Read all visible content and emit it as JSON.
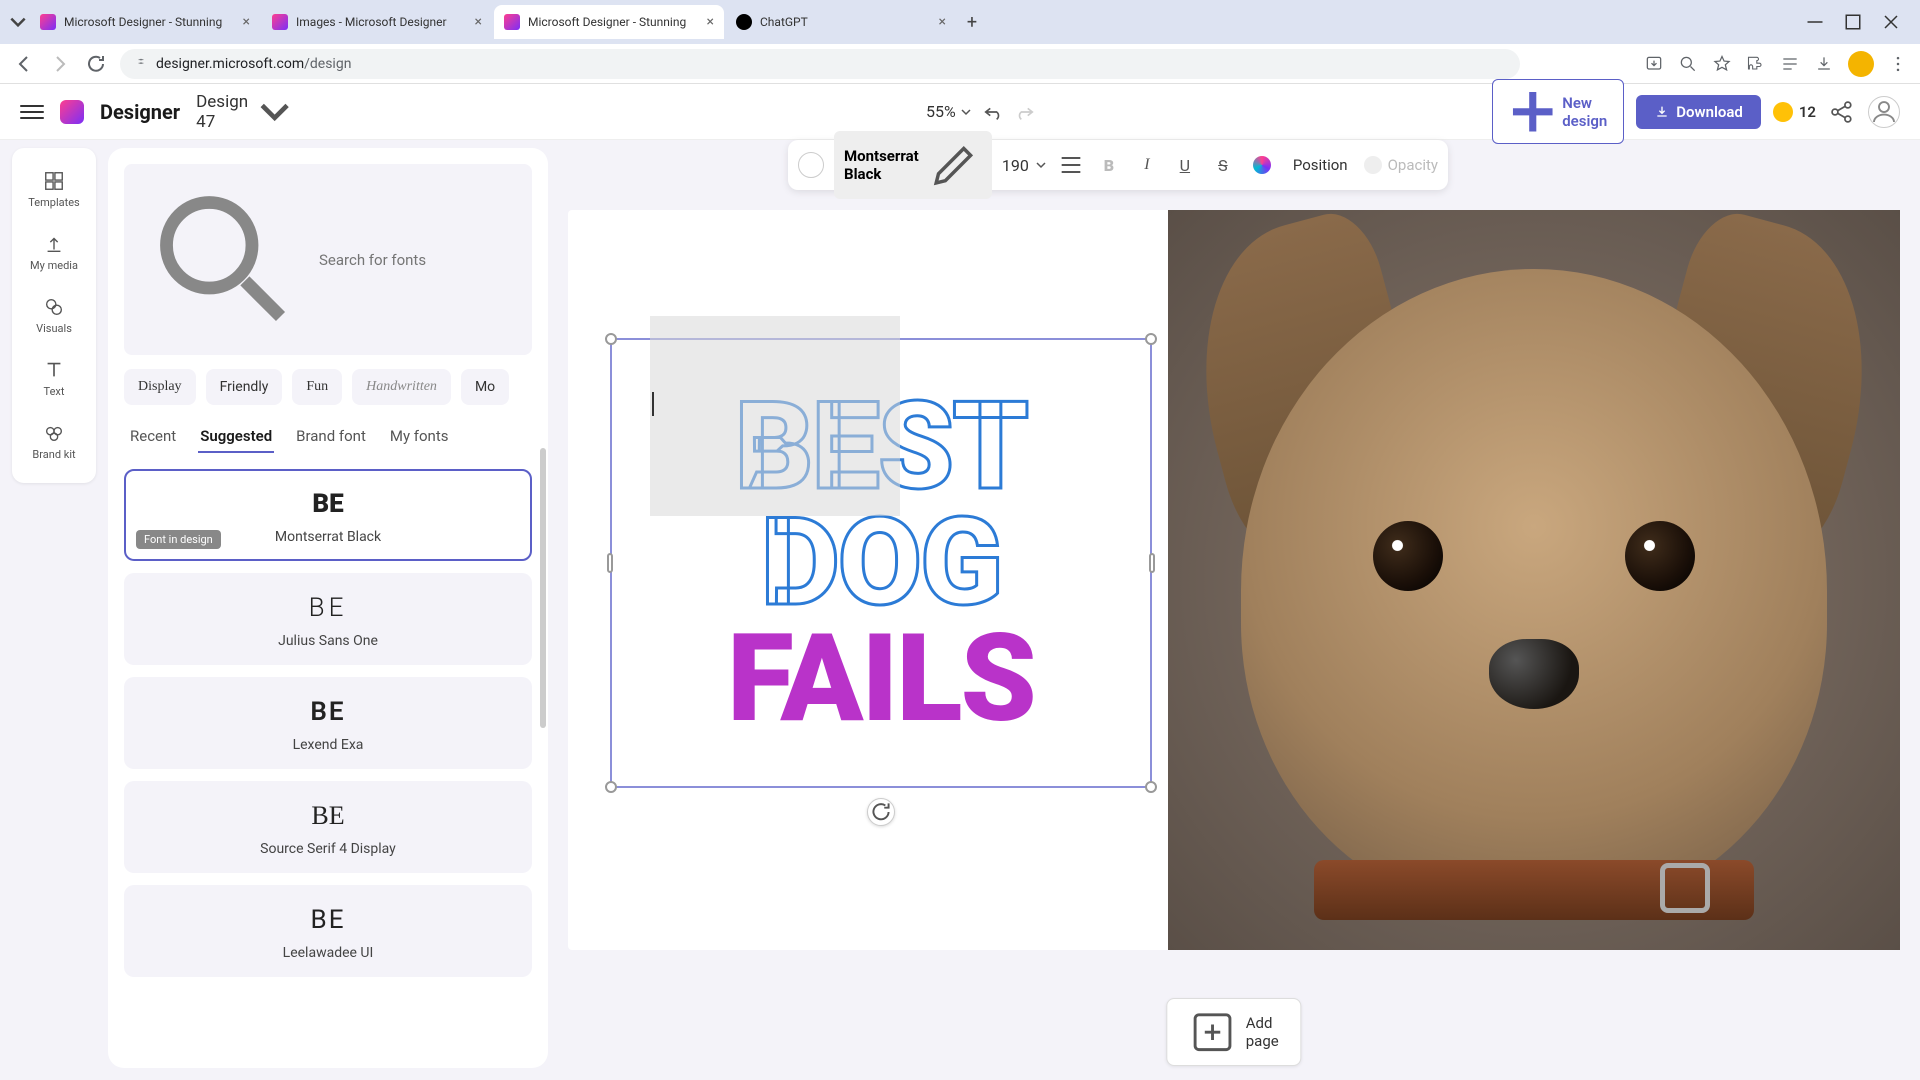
{
  "browser": {
    "tabs": [
      {
        "title": "Microsoft Designer - Stunning",
        "favicon": "designer"
      },
      {
        "title": "Images - Microsoft Designer",
        "favicon": "designer"
      },
      {
        "title": "Microsoft Designer - Stunning",
        "favicon": "designer",
        "active": true
      },
      {
        "title": "ChatGPT",
        "favicon": "chatgpt"
      }
    ],
    "url_domain": "designer.microsoft.com",
    "url_path": "/design"
  },
  "header": {
    "logo_text": "Designer",
    "design_name": "Design 47",
    "zoom": "55%",
    "new_design_label": "New design",
    "download_label": "Download",
    "credits": "12"
  },
  "rail": {
    "items": [
      {
        "label": "Templates",
        "icon": "templates-icon"
      },
      {
        "label": "My media",
        "icon": "upload-icon"
      },
      {
        "label": "Visuals",
        "icon": "visuals-icon"
      },
      {
        "label": "Text",
        "icon": "text-icon"
      },
      {
        "label": "Brand kit",
        "icon": "brandkit-icon"
      }
    ]
  },
  "font_panel": {
    "search_placeholder": "Search for fonts",
    "categories": [
      "Display",
      "Friendly",
      "Fun",
      "Handwritten",
      "Mo"
    ],
    "tabs": [
      "Recent",
      "Suggested",
      "Brand font",
      "My fonts"
    ],
    "active_tab": "Suggested",
    "sample_text": "BE",
    "in_design_badge": "Font in design",
    "fonts": [
      {
        "name": "Montserrat Black",
        "selected": true,
        "in_design": true,
        "style": "black"
      },
      {
        "name": "Julius Sans One",
        "style": "julius"
      },
      {
        "name": "Lexend Exa",
        "style": "lexend"
      },
      {
        "name": "Source Serif 4 Display",
        "style": "serif"
      },
      {
        "name": "Leelawadee UI",
        "style": "leela"
      }
    ]
  },
  "context_toolbar": {
    "font_name": "Montserrat Black",
    "font_size": "190",
    "position_label": "Position",
    "opacity_label": "Opacity"
  },
  "canvas": {
    "text_lines": [
      "BEST",
      "DOG",
      "FAILS"
    ],
    "outline_color": "#2c7bd6",
    "fill_color": "#b933c9",
    "add_page_label": "Add page"
  }
}
